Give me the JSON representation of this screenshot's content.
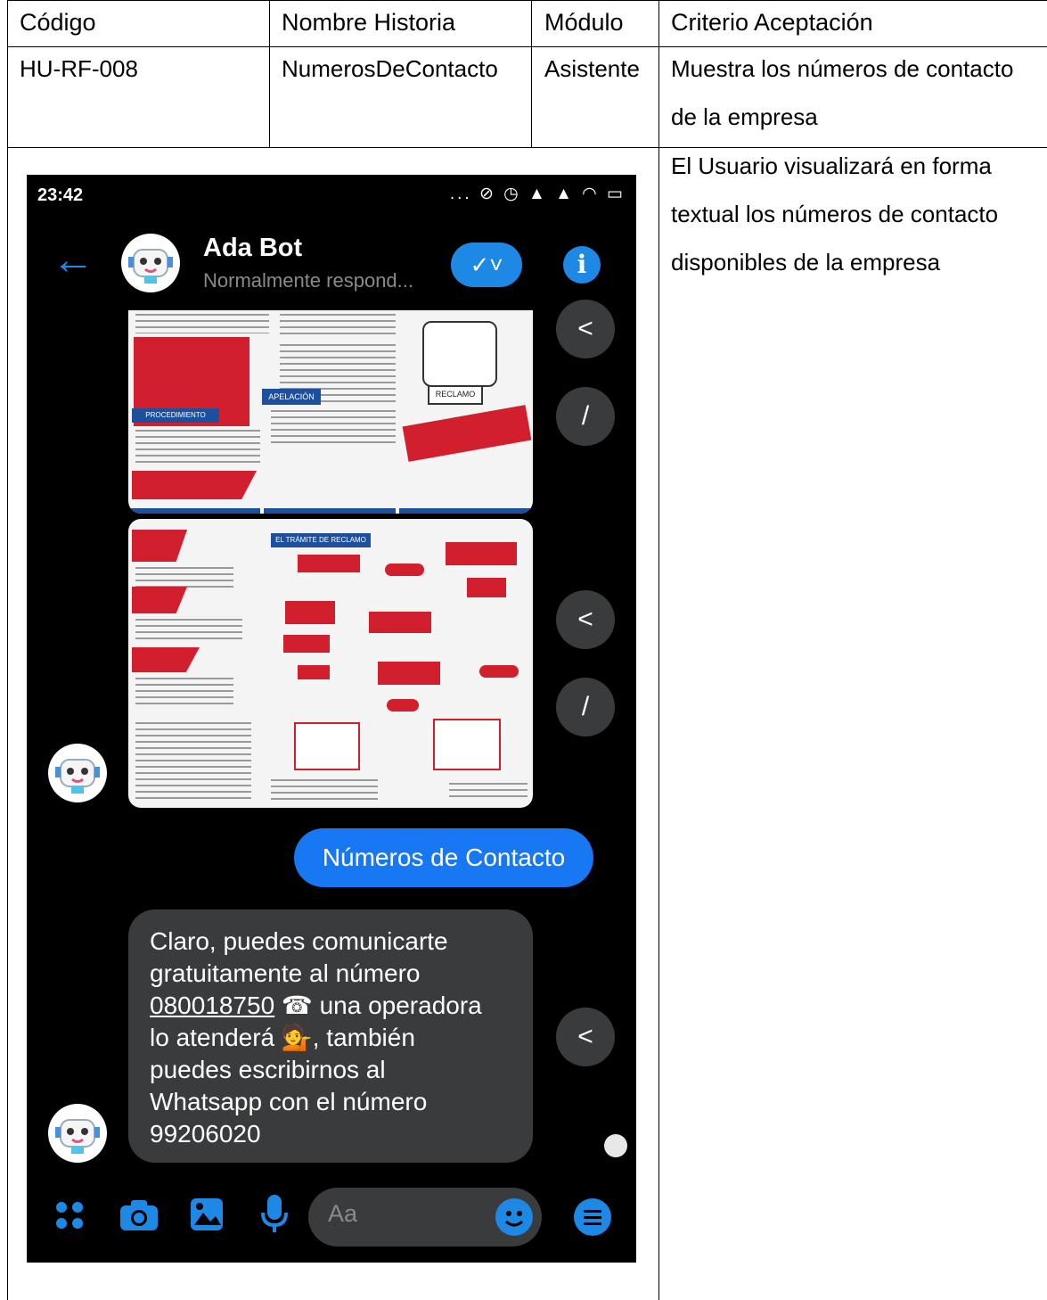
{
  "table": {
    "headers": [
      "Código",
      "Nombre Historia",
      "Módulo",
      "Criterio Aceptación"
    ],
    "row": {
      "codigo": "HU-RF-008",
      "nombre": "NumerosDeContacto",
      "modulo": "Asistente",
      "criterio_line1": "Muestra los números de contacto",
      "criterio_line2": "de la empresa"
    },
    "description_lines": [
      "El Usuario visualizará en forma",
      "textual los números de contacto",
      "disponibles de la  empresa"
    ]
  },
  "phone": {
    "status_time": "23:42",
    "status_icons": "... ⊘ ◷ ▲ ▲ ◠ ▭",
    "header": {
      "back_icon": "←",
      "bot_name": "Ada Bot",
      "subtitle": "Normalmente respond...",
      "check_icon": "✓˅",
      "info_icon": "i"
    },
    "images": {
      "doc1_badge1": "PROCEDIMIENTO",
      "doc1_badge2": "APELACIÓN",
      "doc1_stamp": "RECLAMO",
      "doc2_badge": "EL TRÁMITE DE RECLAMO"
    },
    "outgoing_message": "Números de Contacto",
    "incoming_message": {
      "line1": "Claro, puedes comunicarte",
      "line2": "gratuitamente al número",
      "phone_number": "080018750",
      "line3_rest": " ☎ una operadora",
      "line4": "lo atenderá 💁, también",
      "line5": "puedes escribirnos al",
      "line6": "Whatsapp con el número",
      "line7": "99206020"
    },
    "composer_placeholder": "Aa",
    "share_icon": "<",
    "edit_icon": "/"
  },
  "colors": {
    "messenger_blue": "#1877f2",
    "bubble_gray": "#3a3b3c",
    "accent_red": "#d21f2d"
  }
}
